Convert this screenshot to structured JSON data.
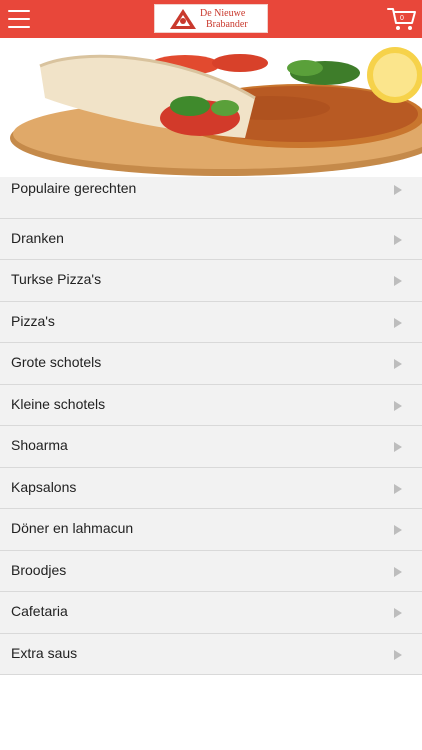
{
  "header": {
    "logo_line1": "De Nieuwe",
    "logo_line2": "Brabander",
    "cart_count": "0",
    "brand_color": "#e8473a"
  },
  "menu": {
    "items": [
      {
        "label": "Populaire gerechten"
      },
      {
        "label": "Dranken"
      },
      {
        "label": "Turkse Pizza's"
      },
      {
        "label": "Pizza's"
      },
      {
        "label": "Grote schotels"
      },
      {
        "label": "Kleine schotels"
      },
      {
        "label": "Shoarma"
      },
      {
        "label": "Kapsalons"
      },
      {
        "label": "Döner en lahmacun"
      },
      {
        "label": "Broodjes"
      },
      {
        "label": "Cafetaria"
      },
      {
        "label": "Extra saus"
      }
    ]
  }
}
